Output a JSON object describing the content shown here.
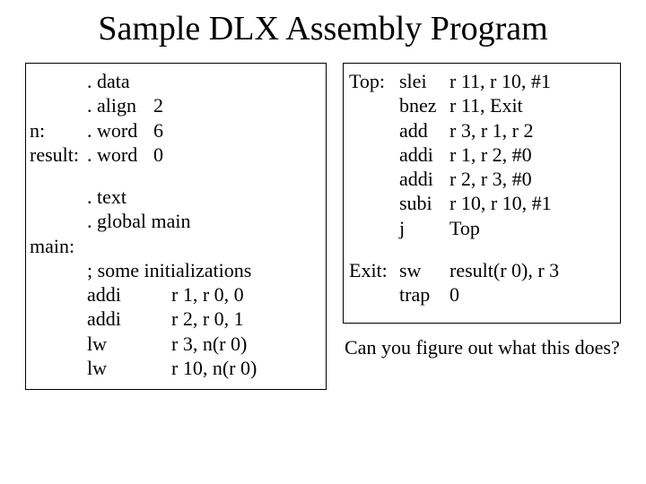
{
  "title": "Sample DLX Assembly Program",
  "left": {
    "block1": [
      {
        "label": "",
        "op": ". data",
        "arg": ""
      },
      {
        "label": "",
        "op": ". align",
        "arg": "2"
      },
      {
        "label": "n:",
        "op": ". word",
        "arg": "6"
      },
      {
        "label": "result:",
        "op": ". word",
        "arg": "0"
      }
    ],
    "block2": [
      {
        "label": "",
        "op": ". text",
        "arg": ""
      },
      {
        "label": "",
        "op": ". global main",
        "arg": ""
      }
    ],
    "main_label": "main:",
    "comment": "; some initializations",
    "block3": [
      {
        "op": "addi",
        "arg": "r 1, r 0, 0"
      },
      {
        "op": "addi",
        "arg": "r 2, r 0, 1"
      },
      {
        "op": "lw",
        "arg": "r 3,  n(r 0)"
      },
      {
        "op": "lw",
        "arg": "r 10, n(r 0)"
      }
    ]
  },
  "right": {
    "rows": [
      {
        "label": "Top:",
        "op": "slei",
        "arg": "r 11, r 10, #1"
      },
      {
        "label": "",
        "op": "bnez",
        "arg": "r 11, Exit"
      },
      {
        "label": "",
        "op": "add",
        "arg": "r 3, r 1, r 2"
      },
      {
        "label": "",
        "op": "addi",
        "arg": "r 1, r 2, #0"
      },
      {
        "label": "",
        "op": "addi",
        "arg": "r 2, r 3, #0"
      },
      {
        "label": "",
        "op": "subi",
        "arg": "r 10, r 10, #1"
      },
      {
        "label": "",
        "op": "j",
        "arg": "Top"
      },
      {
        "gap": true
      },
      {
        "label": "Exit:",
        "op": "sw",
        "arg": "result(r 0), r 3"
      },
      {
        "label": "",
        "op": "trap",
        "arg": "0"
      }
    ]
  },
  "caption": "Can you figure out what this does?"
}
